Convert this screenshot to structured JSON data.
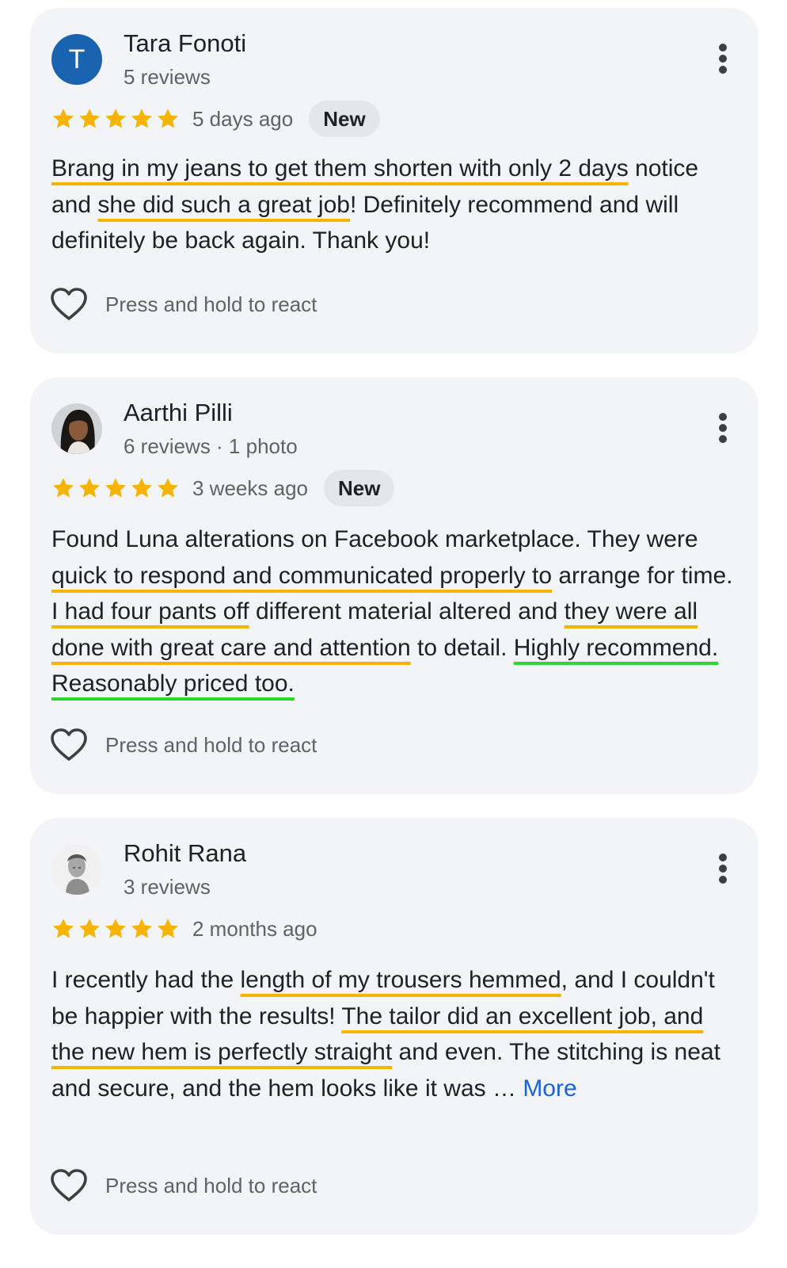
{
  "reviews": [
    {
      "avatar_letter": "T",
      "name": "Tara Fonoti",
      "meta": "5 reviews",
      "rating": 5,
      "time_ago": "5 days ago",
      "badge": "New",
      "text": {
        "p1": "Brang in my jeans to get them shorten with only 2 days",
        "p2": " notice and ",
        "p3": "she did such a great job",
        "p4": "! Definitely recommend and will definitely be back again. Thank you!"
      },
      "react_label": "Press and hold to react"
    },
    {
      "avatar_icon": "profile-photo",
      "name": "Aarthi Pilli",
      "meta": "6 reviews · 1 photo",
      "rating": 5,
      "time_ago": "3 weeks ago",
      "badge": "New",
      "text": {
        "p1": "Found Luna alterations on Facebook marketplace. They were ",
        "p2": "quick to respond and communicated properly to",
        "p3": " arrange for time. ",
        "p4": "I had four pants off",
        "p5": " different material altered and ",
        "p6": "they were all done with great care and attention",
        "p7": " to detail. ",
        "p8": "Highly recommend. Reasonably priced too."
      },
      "react_label": "Press and hold to react"
    },
    {
      "avatar_icon": "statue-photo",
      "name": "Rohit Rana",
      "meta": "3 reviews",
      "rating": 5,
      "time_ago": "2 months ago",
      "text": {
        "p1": "I recently had the ",
        "p2": "length of my trousers hemmed",
        "p3": ", and I couldn't be happier with the results! ",
        "p4": "The tailor did an excellent job, and the new hem is perfectly straight",
        "p5": " and even. The stitching is neat and secure, and the hem looks like it was … ",
        "more": "More"
      },
      "react_label": "Press and hold to react"
    }
  ],
  "colors": {
    "card_bg": "#f2f4f7",
    "star": "#f6b400",
    "highlight_orange": "#f6b400",
    "highlight_green": "#2bd82b",
    "avatar_blue": "#1a63b1",
    "link": "#1a63d6"
  }
}
